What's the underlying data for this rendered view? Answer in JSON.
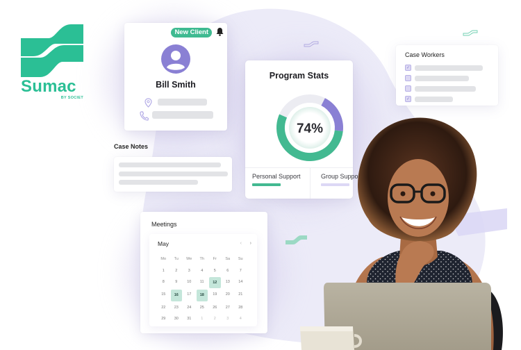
{
  "brand": {
    "name": "Sumac",
    "tagline": "BY SOCIET",
    "accent_color": "#2bbf95",
    "secondary_color": "#8a80d4"
  },
  "client_card": {
    "badge": "New Client",
    "notification_icon": "bell-icon",
    "avatar_icon": "user-avatar-icon",
    "name": "Bill Smith",
    "address_icon": "location-pin-icon",
    "phone_icon": "phone-icon"
  },
  "case_notes": {
    "title": "Case Notes"
  },
  "program_stats": {
    "title": "Program Stats",
    "percent_label": "74%",
    "percent_value": 74,
    "segments": [
      {
        "name": "Personal Support",
        "fraction": 0.55,
        "color": "#43b991"
      },
      {
        "name": "Group Support",
        "fraction": 0.19,
        "color": "#8a80d4"
      }
    ],
    "legend": [
      {
        "label": "Personal Support",
        "color": "#43b991"
      },
      {
        "label": "Group Suppor",
        "color": "#dcd8f5"
      }
    ]
  },
  "case_workers": {
    "title": "Case Workers",
    "items": [
      {
        "checked": true
      },
      {
        "checked": false
      },
      {
        "checked": false
      },
      {
        "checked": true
      }
    ]
  },
  "meetings": {
    "title": "Meetings",
    "calendar": {
      "month": "May",
      "prev_icon": "chevron-left-icon",
      "next_icon": "chevron-right-icon",
      "weekdays": [
        "Mo",
        "Tu",
        "We",
        "Th",
        "Fr",
        "Sa",
        "Su"
      ],
      "weeks": [
        [
          "1",
          "2",
          "3",
          "4",
          "5",
          "6",
          "7"
        ],
        [
          "8",
          "9",
          "10",
          "11",
          "12",
          "13",
          "14"
        ],
        [
          "15",
          "16",
          "17",
          "18",
          "19",
          "20",
          "21"
        ],
        [
          "22",
          "23",
          "24",
          "25",
          "26",
          "27",
          "28"
        ],
        [
          "29",
          "30",
          "31",
          "1",
          "2",
          "3",
          "4"
        ]
      ],
      "selected_days": [
        "12",
        "16",
        "18"
      ],
      "trailing_days_next_month": [
        "1",
        "2",
        "3",
        "4"
      ]
    }
  }
}
